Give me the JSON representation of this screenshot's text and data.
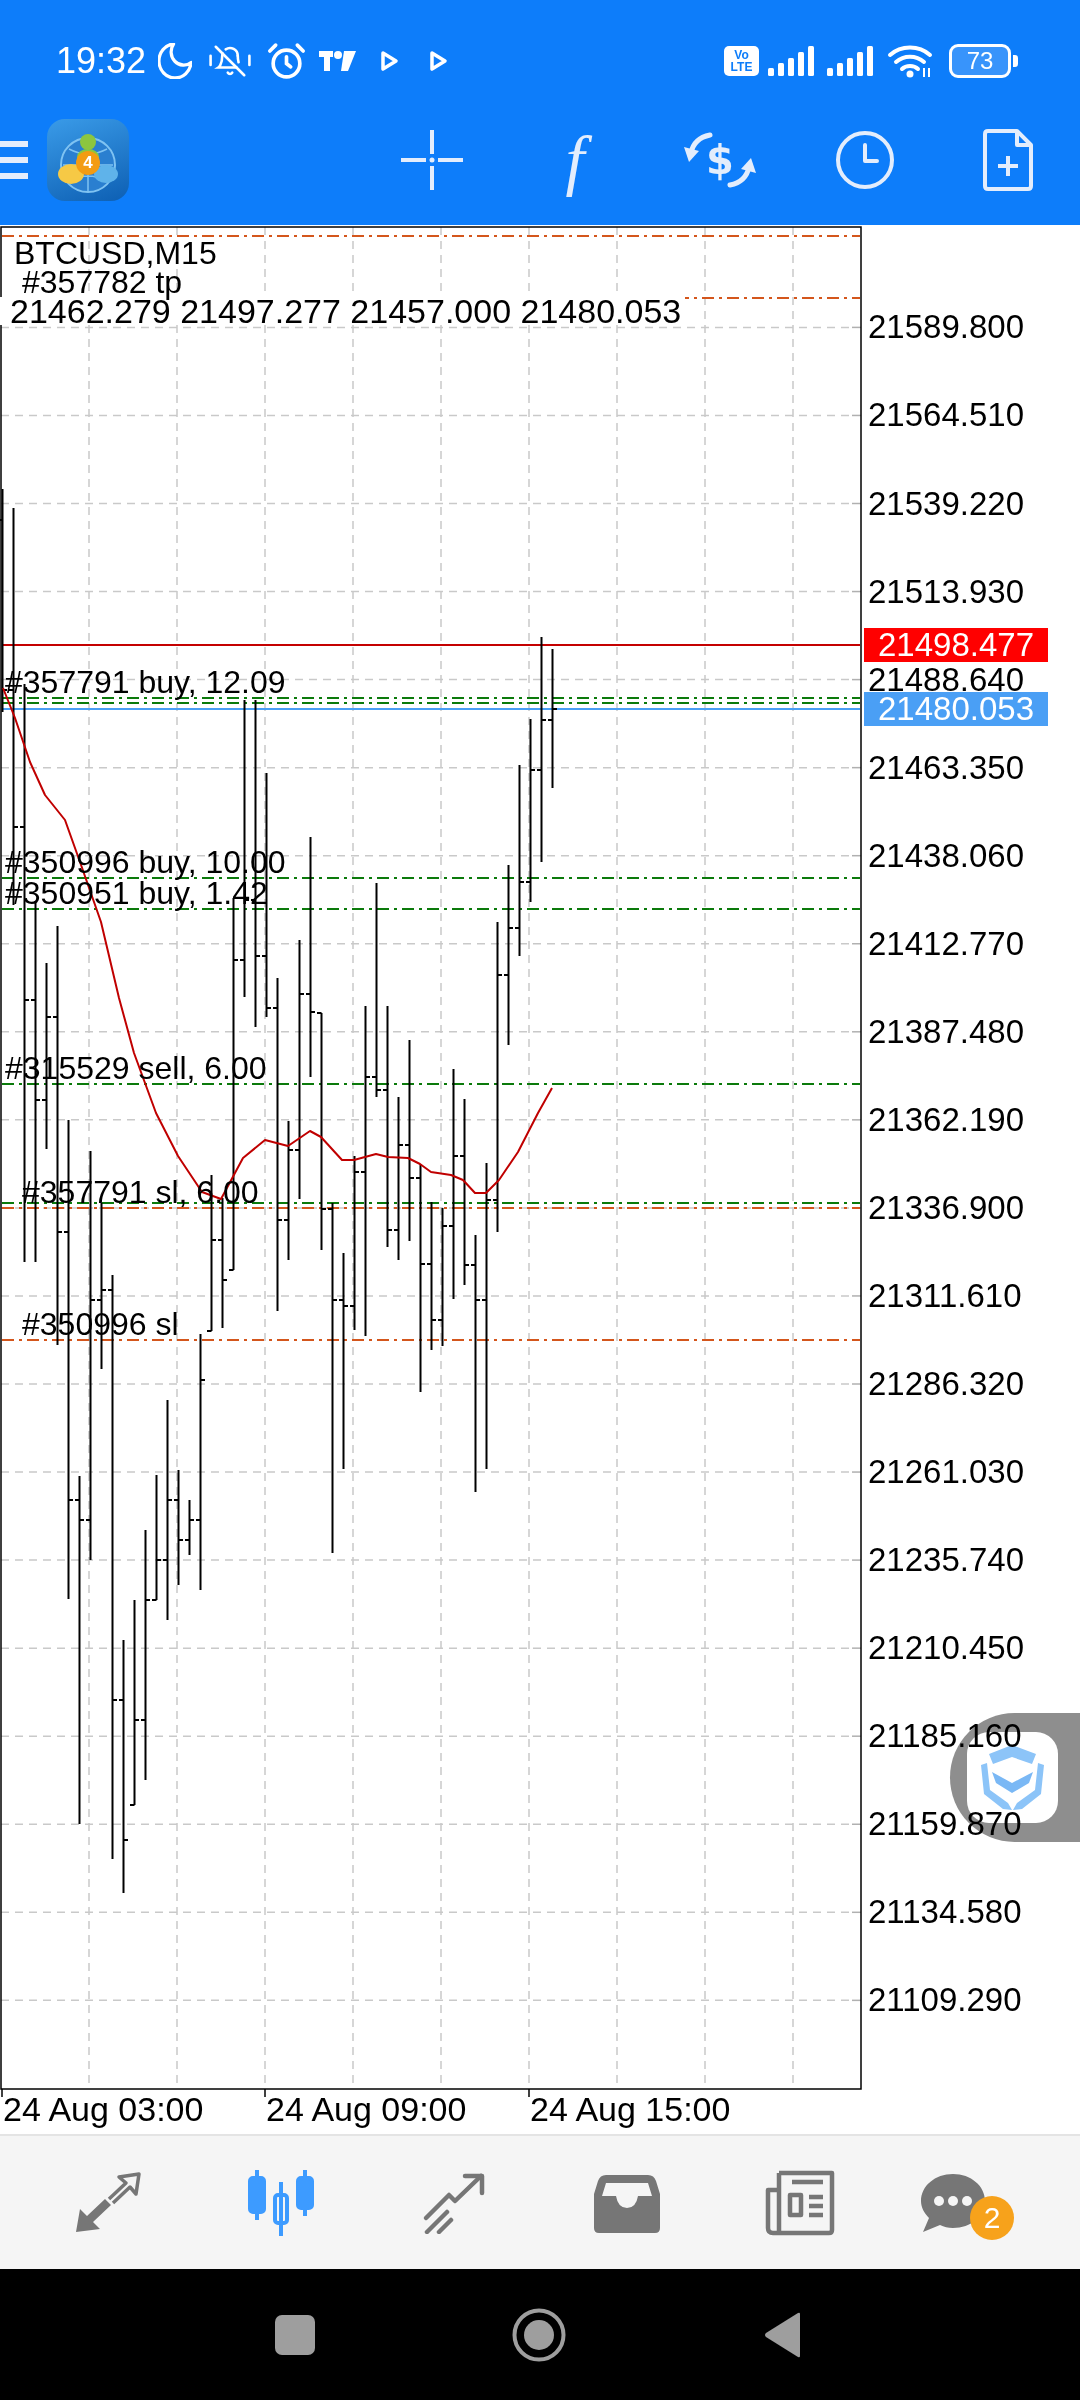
{
  "status_bar": {
    "time": "19:32",
    "network_badge": "Vo LTE",
    "battery": "73"
  },
  "toolbar": {
    "logo_badge": "4",
    "buttons": [
      {
        "kind": "menu"
      },
      {
        "kind": "crosshair"
      },
      {
        "kind": "indicators",
        "glyph": "f"
      },
      {
        "kind": "trade",
        "glyph": "$"
      },
      {
        "kind": "period"
      },
      {
        "kind": "new_order"
      }
    ]
  },
  "chart": {
    "title": "BTCUSD,M15",
    "ohlc": "21462.279 21497.277 21457.000 21480.053",
    "trade_lines": [
      {
        "kind": "exit"
      },
      {
        "kind": "exit",
        "label": "#357782 tp"
      },
      {
        "kind": "entry",
        "label": "#357791 buy, 12.09"
      },
      {
        "kind": "entry"
      },
      {
        "kind": "entry",
        "label": "#350996 buy, 10.00"
      },
      {
        "kind": "entry",
        "label": "#350951 buy, 1.42"
      },
      {
        "kind": "entry",
        "label": "#315529 sell, 6.00"
      },
      {
        "kind": "entry"
      },
      {
        "kind": "exit",
        "label": "#357791 sl, 6.00"
      },
      {
        "kind": "exit",
        "label": "#350996 sl"
      }
    ],
    "price_tags": [
      {
        "kind": "ask",
        "value": "21498.477"
      },
      {
        "kind": "bid",
        "value": "21480.053"
      }
    ],
    "price_scale": [
      "21589.800",
      "21564.510",
      "21539.220",
      "21513.930",
      "21488.640",
      "21463.350",
      "21438.060",
      "21412.770",
      "21387.480",
      "21362.190",
      "21336.900",
      "21311.610",
      "21286.320",
      "21261.030",
      "21235.740",
      "21210.450",
      "21185.160",
      "21159.870",
      "21134.580",
      "21109.290"
    ],
    "time_scale": [
      "24 Aug 03:00",
      "24 Aug 09:00",
      "24 Aug 15:00"
    ]
  },
  "bottom_nav": [
    {
      "kind": "trade",
      "selected": false
    },
    {
      "kind": "chart",
      "selected": true
    },
    {
      "kind": "history",
      "selected": false
    },
    {
      "kind": "mailbox",
      "selected": false
    },
    {
      "kind": "news",
      "selected": false
    },
    {
      "kind": "chat",
      "selected": false,
      "badge": "2"
    }
  ]
}
